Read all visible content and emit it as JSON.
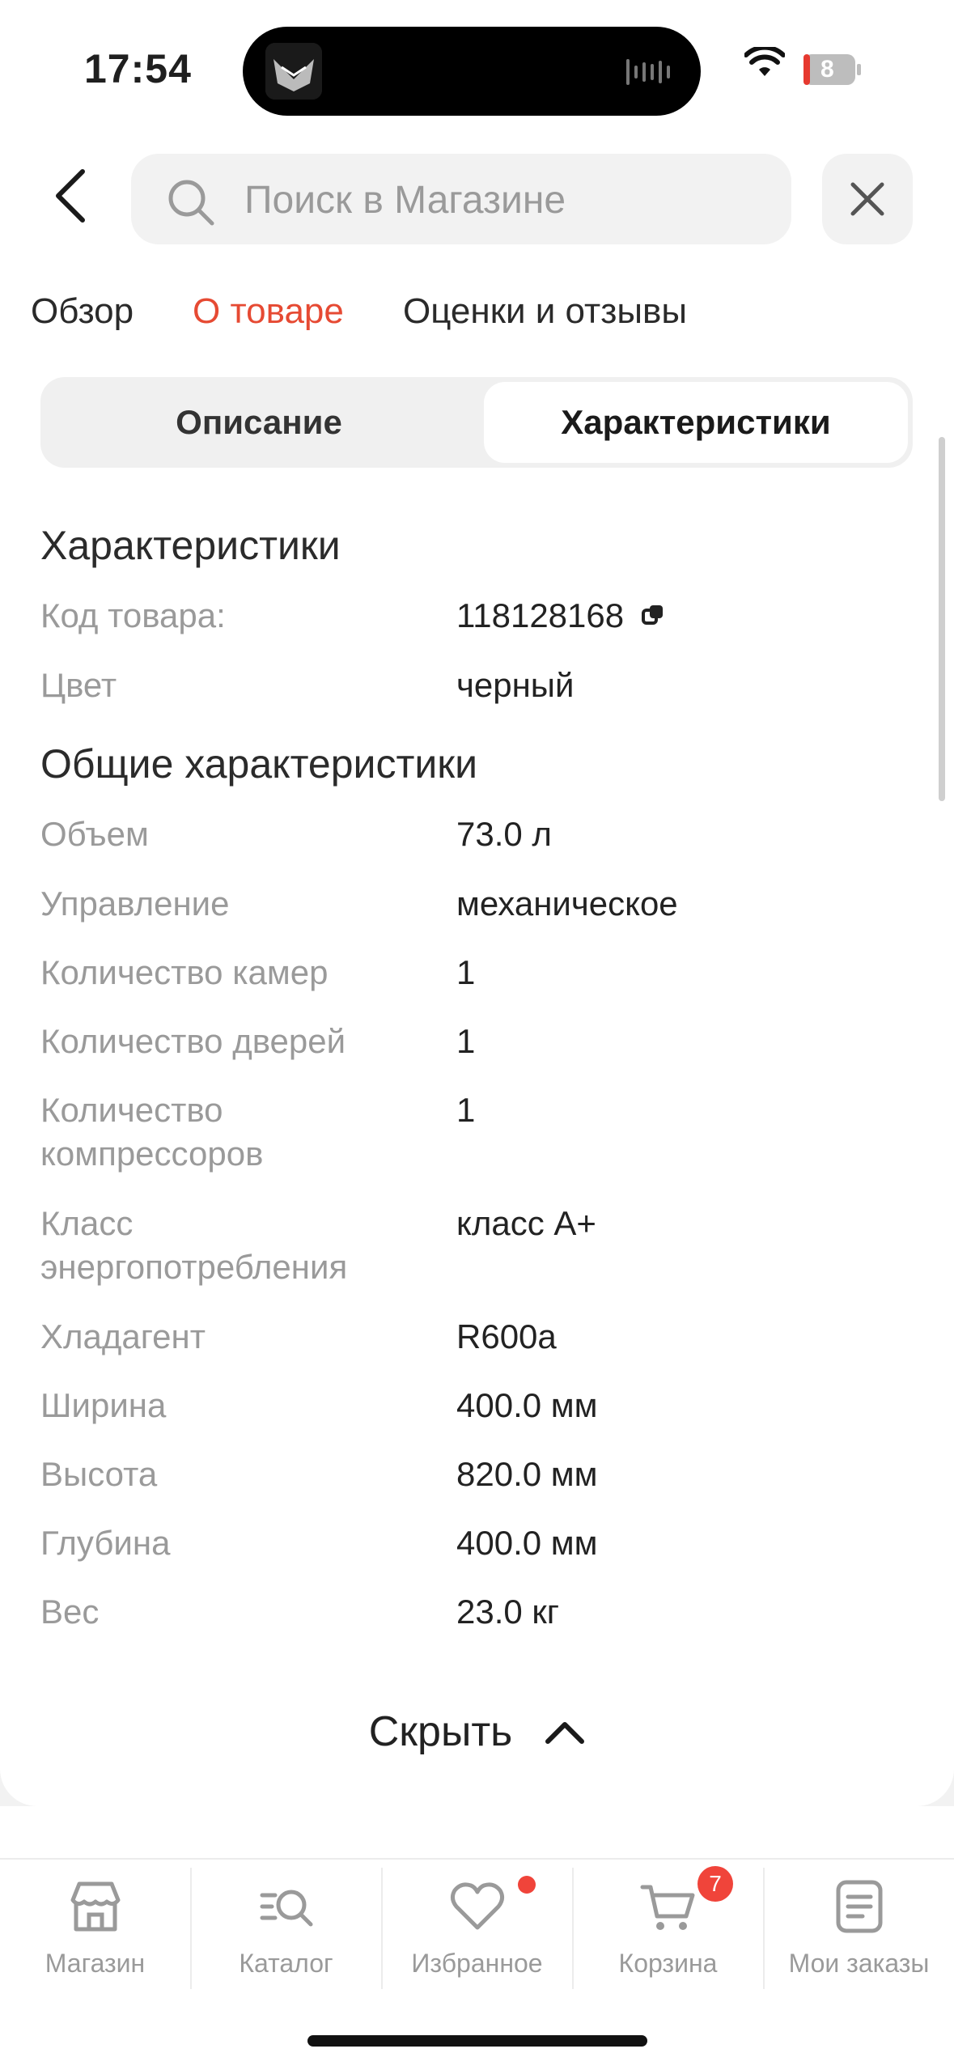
{
  "status_bar": {
    "time": "17:54",
    "battery": "8"
  },
  "search": {
    "placeholder": "Поиск в Магазине"
  },
  "tabs": [
    {
      "label": "Обзор"
    },
    {
      "label": "О товаре",
      "active": true
    },
    {
      "label": "Оценки и отзывы"
    }
  ],
  "segment": {
    "left": "Описание",
    "right": "Характеристики",
    "selected": "right"
  },
  "sections": [
    {
      "title": "Характеристики",
      "rows": [
        {
          "label": "Код товара:",
          "value": "118128168"
        },
        {
          "label": "Цвет",
          "value": "черный"
        }
      ]
    },
    {
      "title": "Общие характеристики",
      "rows": [
        {
          "label": "Объем",
          "value": "73.0 л"
        },
        {
          "label": "Управление",
          "value": "механическое"
        },
        {
          "label": "Количество камер",
          "value": "1"
        },
        {
          "label": "Количество дверей",
          "value": "1"
        },
        {
          "label": "Количество компрессоров",
          "value": "1"
        },
        {
          "label": "Класс энергопотребления",
          "value": "класс A+"
        },
        {
          "label": "Хладагент",
          "value": "R600a"
        },
        {
          "label": "Ширина",
          "value": "400.0 мм"
        },
        {
          "label": "Высота",
          "value": "820.0 мм"
        },
        {
          "label": "Глубина",
          "value": "400.0 мм"
        },
        {
          "label": "Вес",
          "value": "23.0 кг"
        }
      ]
    }
  ],
  "hide_label": "Скрыть",
  "bottom_nav": [
    {
      "label": "Магазин",
      "icon": "store-icon"
    },
    {
      "label": "Каталог",
      "icon": "catalog-search-icon"
    },
    {
      "label": "Избранное",
      "icon": "heart-icon",
      "dot": true
    },
    {
      "label": "Корзина",
      "icon": "cart-icon",
      "badge": "7"
    },
    {
      "label": "Мои заказы",
      "icon": "orders-icon"
    }
  ],
  "colors": {
    "accent": "#e64a33",
    "badge": "#f0443a",
    "muted": "#9a9a9a"
  }
}
